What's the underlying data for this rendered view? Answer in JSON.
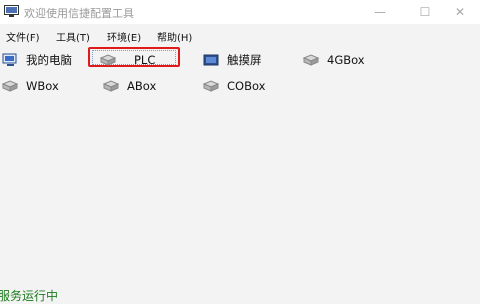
{
  "window": {
    "title": "欢迎使用信捷配置工具",
    "minimize_glyph": "—",
    "maximize_glyph": "☐",
    "close_glyph": "✕"
  },
  "menu": {
    "items": [
      {
        "label": "文件(F)"
      },
      {
        "label": "工具(T)"
      },
      {
        "label": "环境(E)"
      },
      {
        "label": "帮助(H)"
      }
    ]
  },
  "toolbar": {
    "items": [
      {
        "label": "我的电脑",
        "icon": "my-computer-icon"
      },
      {
        "label": "PLC",
        "icon": "device-box-icon",
        "highlighted": true
      },
      {
        "label": "触摸屏",
        "icon": "touchscreen-icon"
      },
      {
        "label": "4GBox",
        "icon": "device-box-icon"
      },
      {
        "label": "WBox",
        "icon": "device-box-icon"
      },
      {
        "label": "ABox",
        "icon": "device-box-icon"
      },
      {
        "label": "COBox",
        "icon": "device-box-icon"
      }
    ],
    "highlight_color": "#e01a1a"
  },
  "status": {
    "text": "服务运行中",
    "color": "#1e7b1e"
  }
}
